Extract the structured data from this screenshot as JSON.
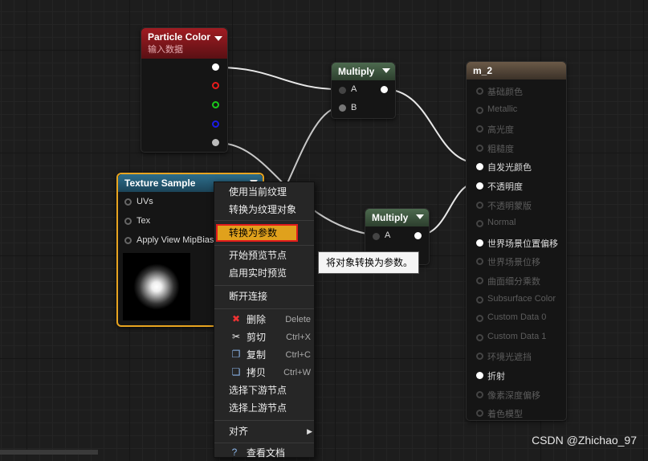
{
  "particle_node": {
    "title": "Particle Color",
    "subtitle": "输入数据"
  },
  "multiply1": {
    "title": "Multiply",
    "pin_a": "A",
    "pin_b": "B"
  },
  "multiply2": {
    "title": "Multiply",
    "pin_a": "A"
  },
  "texture_node": {
    "title": "Texture Sample",
    "pins": [
      "UVs",
      "Tex",
      "Apply View MipBias"
    ]
  },
  "material_node": {
    "title": "m_2",
    "pins": [
      {
        "label": "基础颜色",
        "active": false
      },
      {
        "label": "Metallic",
        "active": false
      },
      {
        "label": "高光度",
        "active": false
      },
      {
        "label": "粗糙度",
        "active": false
      },
      {
        "label": "自发光颜色",
        "active": true
      },
      {
        "label": "不透明度",
        "active": true
      },
      {
        "label": "不透明蒙版",
        "active": false
      },
      {
        "label": "Normal",
        "active": false
      },
      {
        "label": "世界场景位置偏移",
        "active": true
      },
      {
        "label": "世界场景位移",
        "active": false
      },
      {
        "label": "曲面细分乘数",
        "active": false
      },
      {
        "label": "Subsurface Color",
        "active": false
      },
      {
        "label": "Custom Data 0",
        "active": false
      },
      {
        "label": "Custom Data 1",
        "active": false
      },
      {
        "label": "环境光遮挡",
        "active": false
      },
      {
        "label": "折射",
        "active": true
      },
      {
        "label": "像素深度偏移",
        "active": false
      },
      {
        "label": "着色模型",
        "active": false
      }
    ]
  },
  "context_menu": {
    "items": {
      "use_current_texture": "使用当前纹理",
      "convert_to_texture_object": "转换为纹理对象",
      "convert_to_parameter": "转换为参数",
      "start_preview_node": "开始预览节点",
      "enable_realtime_preview": "启用实时预览",
      "break_links": "断开连接",
      "delete": "删除",
      "delete_sc": "Delete",
      "cut": "剪切",
      "cut_sc": "Ctrl+X",
      "copy": "复制",
      "copy_sc": "Ctrl+C",
      "paste": "拷贝",
      "paste_sc": "Ctrl+W",
      "select_downstream": "选择下游节点",
      "select_upstream": "选择上游节点",
      "align": "对齐",
      "view_docs": "查看文档"
    }
  },
  "tooltip": "将对象转换为参数。",
  "watermark": "CSDN @Zhichao_97",
  "icons": [
    "collapse-arrow-icon",
    "delete-icon",
    "scissors-icon",
    "copy-icon",
    "paste-icon",
    "submenu-arrow-icon",
    "help-icon"
  ]
}
